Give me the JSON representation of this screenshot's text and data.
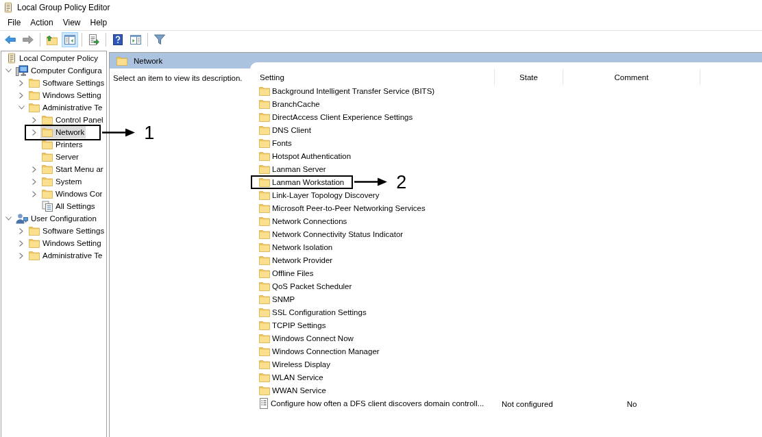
{
  "window": {
    "title": "Local Group Policy Editor"
  },
  "menu": [
    "File",
    "Action",
    "View",
    "Help"
  ],
  "toolbar": {
    "groups": [
      [
        {
          "kind": "back",
          "pressed": false,
          "disabled": false
        },
        {
          "kind": "forward",
          "pressed": false,
          "disabled": true
        }
      ],
      [
        {
          "kind": "up",
          "pressed": false,
          "disabled": false
        },
        {
          "kind": "tree-toggle",
          "pressed": true,
          "disabled": false
        }
      ],
      [
        {
          "kind": "export",
          "pressed": false,
          "disabled": false
        }
      ],
      [
        {
          "kind": "help",
          "pressed": false,
          "disabled": false
        },
        {
          "kind": "action-pane",
          "pressed": false,
          "disabled": false
        }
      ],
      [
        {
          "kind": "filter",
          "pressed": false,
          "disabled": false
        }
      ]
    ]
  },
  "tree": {
    "items": [
      {
        "label": "Local Computer Policy",
        "kind": "policy",
        "selected": false,
        "children": [
          {
            "label": "Computer Configura",
            "kind": "computer",
            "expanded": true,
            "selected": false,
            "children": [
              {
                "label": "Software Settings",
                "kind": "folder",
                "expanded": false,
                "selected": false
              },
              {
                "label": "Windows Setting",
                "kind": "folder",
                "expanded": false,
                "selected": false
              },
              {
                "label": "Administrative Te",
                "kind": "folder",
                "expanded": true,
                "selected": false,
                "children": [
                  {
                    "label": "Control Panel",
                    "kind": "folder",
                    "expanded": false,
                    "selected": false
                  },
                  {
                    "label": "Network",
                    "kind": "folder",
                    "expanded": false,
                    "selected": true,
                    "callout": "1"
                  },
                  {
                    "label": "Printers",
                    "kind": "folder",
                    "selected": false
                  },
                  {
                    "label": "Server",
                    "kind": "folder",
                    "selected": false
                  },
                  {
                    "label": "Start Menu ar",
                    "kind": "folder",
                    "expanded": false,
                    "selected": false
                  },
                  {
                    "label": "System",
                    "kind": "folder",
                    "expanded": false,
                    "selected": false
                  },
                  {
                    "label": "Windows Cor",
                    "kind": "folder",
                    "expanded": false,
                    "selected": false
                  },
                  {
                    "label": "All Settings",
                    "kind": "settings",
                    "selected": false
                  }
                ]
              }
            ]
          },
          {
            "label": "User Configuration",
            "kind": "user",
            "expanded": true,
            "selected": false,
            "children": [
              {
                "label": "Software Settings",
                "kind": "folder",
                "expanded": false,
                "selected": false
              },
              {
                "label": "Windows Setting",
                "kind": "folder",
                "expanded": false,
                "selected": false
              },
              {
                "label": "Administrative Te",
                "kind": "folder",
                "expanded": false,
                "selected": false
              }
            ]
          }
        ]
      }
    ]
  },
  "details": {
    "title": "Network",
    "description": "Select an item to view its description.",
    "columns": [
      "Setting",
      "State",
      "Comment"
    ],
    "rows": [
      {
        "kind": "folder",
        "setting": "Background Intelligent Transfer Service (BITS)",
        "selected": false
      },
      {
        "kind": "folder",
        "setting": "BranchCache",
        "selected": false
      },
      {
        "kind": "folder",
        "setting": "DirectAccess Client Experience Settings",
        "selected": false
      },
      {
        "kind": "folder",
        "setting": "DNS Client",
        "selected": false
      },
      {
        "kind": "folder",
        "setting": "Fonts",
        "selected": false
      },
      {
        "kind": "folder",
        "setting": "Hotspot Authentication",
        "selected": false
      },
      {
        "kind": "folder",
        "setting": "Lanman Server",
        "selected": false
      },
      {
        "kind": "folder",
        "setting": "Lanman Workstation",
        "selected": false,
        "callout": "2"
      },
      {
        "kind": "folder",
        "setting": "Link-Layer Topology Discovery",
        "selected": false
      },
      {
        "kind": "folder",
        "setting": "Microsoft Peer-to-Peer Networking Services",
        "selected": false
      },
      {
        "kind": "folder",
        "setting": "Network Connections",
        "selected": false
      },
      {
        "kind": "folder",
        "setting": "Network Connectivity Status Indicator",
        "selected": false
      },
      {
        "kind": "folder",
        "setting": "Network Isolation",
        "selected": false
      },
      {
        "kind": "folder",
        "setting": "Network Provider",
        "selected": false
      },
      {
        "kind": "folder",
        "setting": "Offline Files",
        "selected": false
      },
      {
        "kind": "folder",
        "setting": "QoS Packet Scheduler",
        "selected": false
      },
      {
        "kind": "folder",
        "setting": "SNMP",
        "selected": false
      },
      {
        "kind": "folder",
        "setting": "SSL Configuration Settings",
        "selected": false
      },
      {
        "kind": "folder",
        "setting": "TCPIP Settings",
        "selected": false
      },
      {
        "kind": "folder",
        "setting": "Windows Connect Now",
        "selected": false
      },
      {
        "kind": "folder",
        "setting": "Windows Connection Manager",
        "selected": false
      },
      {
        "kind": "folder",
        "setting": "Wireless Display",
        "selected": false
      },
      {
        "kind": "folder",
        "setting": "WLAN Service",
        "selected": false
      },
      {
        "kind": "folder",
        "setting": "WWAN Service",
        "selected": false
      },
      {
        "kind": "policy",
        "setting": "Configure how often a DFS client discovers domain controll...",
        "state": "Not configured",
        "comment": "No",
        "selected": false
      }
    ]
  }
}
